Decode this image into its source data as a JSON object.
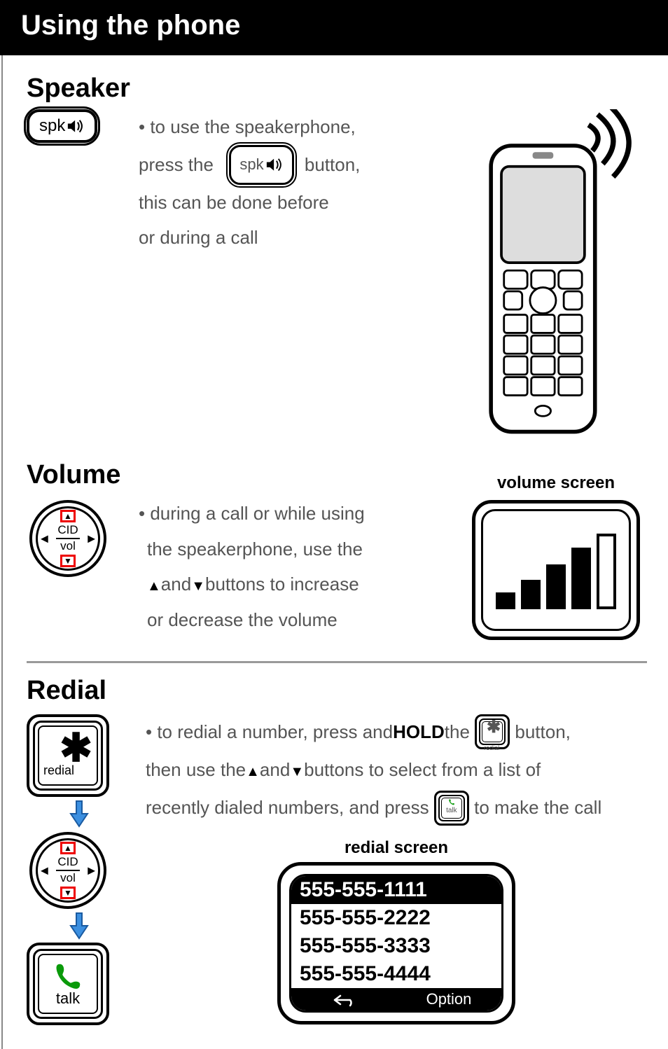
{
  "banner_title": "Using the phone",
  "sections": {
    "speaker": {
      "heading": "Speaker",
      "btn_label": "spk",
      "text_before": "• to use the speakerphone,",
      "text_press1": "press the",
      "text_press2": "button,",
      "text_line3": "this can be done before",
      "text_line4": "or during a call"
    },
    "volume": {
      "heading": "Volume",
      "screen_title": "volume screen",
      "nav_top_label": "CID",
      "nav_bot_label": "vol",
      "text1": "• during a call or while using",
      "text2": "the speakerphone, use the",
      "text3a": "",
      "text3_and": " and ",
      "text3b": " buttons to increase",
      "text4": "or decrease the volume"
    },
    "redial": {
      "heading": "Redial",
      "key_star_sub": "redial",
      "talk_label": "talk",
      "text1a": "• to redial a number, press and ",
      "hold": "HOLD",
      "text1b": " the ",
      "text1c": " button,",
      "text2a": "then use the ",
      "text2b": " buttons to select from a list of",
      "text3a": "recently dialed numbers, and press ",
      "text3b": " to make the call",
      "screen_title": "redial screen",
      "numbers": [
        "555-555-1111",
        "555-555-2222",
        "555-555-3333",
        "555-555-4444"
      ],
      "softkeys": {
        "back_glyph": "↩",
        "option": "Option"
      }
    }
  }
}
